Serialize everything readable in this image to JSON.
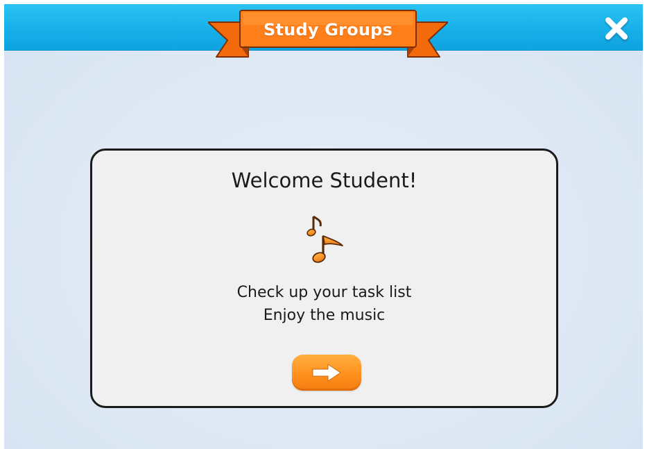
{
  "header": {
    "title": "Study Groups"
  },
  "icons": {
    "close": "close-icon",
    "music": "music-notes-icon",
    "next": "arrow-right-icon"
  },
  "dialog": {
    "heading": "Welcome Student!",
    "message_line_1": "Check up your task list",
    "message_line_2": "Enjoy the music"
  },
  "colors": {
    "header_blue": "#16aee8",
    "ribbon_orange": "#ff7a14",
    "button_orange": "#ff9320",
    "card_background": "#f0f0f0",
    "page_background": "#dfe9f5"
  }
}
